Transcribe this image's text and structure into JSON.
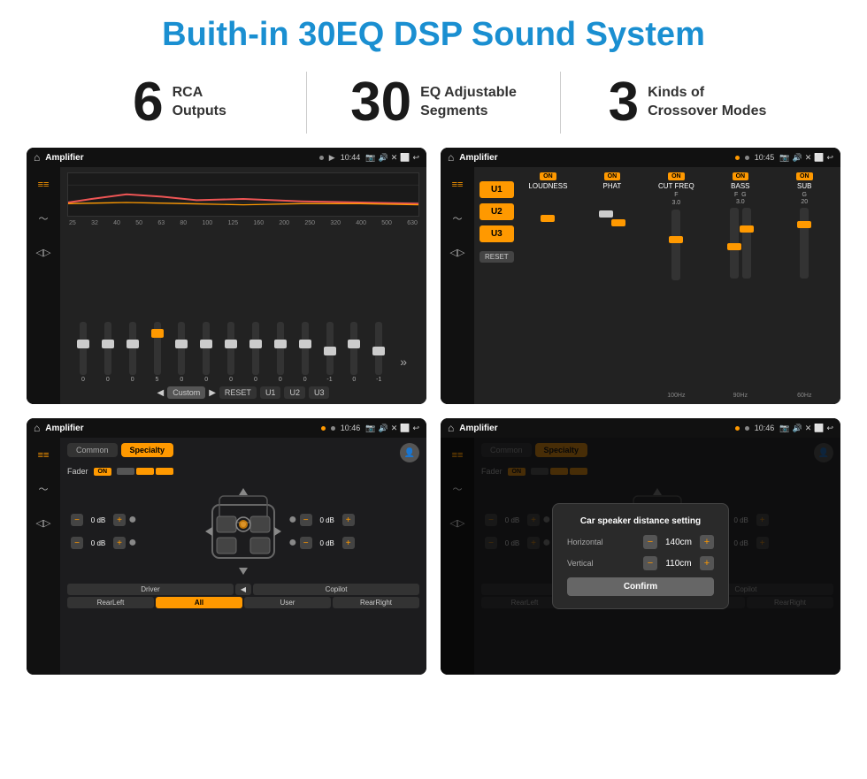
{
  "header": {
    "title": "Buith-in 30EQ DSP Sound System"
  },
  "stats": [
    {
      "number": "6",
      "label_line1": "RCA",
      "label_line2": "Outputs"
    },
    {
      "number": "30",
      "label_line1": "EQ Adjustable",
      "label_line2": "Segments"
    },
    {
      "number": "3",
      "label_line1": "Kinds of",
      "label_line2": "Crossover Modes"
    }
  ],
  "screens": [
    {
      "id": "eq-screen",
      "app_name": "Amplifier",
      "time": "10:44",
      "type": "eq",
      "freqs": [
        "25",
        "32",
        "40",
        "50",
        "63",
        "80",
        "100",
        "125",
        "160",
        "200",
        "250",
        "320",
        "400",
        "500",
        "630"
      ],
      "vals": [
        "0",
        "0",
        "0",
        "5",
        "0",
        "0",
        "0",
        "0",
        "0",
        "0",
        "-1",
        "0",
        "-1"
      ],
      "nav_items": [
        "Custom",
        "RESET",
        "U1",
        "U2",
        "U3"
      ]
    },
    {
      "id": "crossover-screen",
      "app_name": "Amplifier",
      "time": "10:45",
      "type": "crossover",
      "u_buttons": [
        "U1",
        "U2",
        "U3"
      ],
      "channels": [
        {
          "name": "LOUDNESS",
          "on": true,
          "val": ""
        },
        {
          "name": "PHAT",
          "on": true,
          "val": ""
        },
        {
          "name": "CUT FREQ",
          "on": true,
          "val": ""
        },
        {
          "name": "BASS",
          "on": true,
          "val": ""
        },
        {
          "name": "SUB",
          "on": true,
          "val": ""
        }
      ],
      "reset_label": "RESET"
    },
    {
      "id": "common-screen",
      "app_name": "Amplifier",
      "time": "10:46",
      "type": "common",
      "tabs": [
        "Common",
        "Specialty"
      ],
      "active_tab": "Specialty",
      "fader_label": "Fader",
      "fader_on": true,
      "spk_rows": [
        {
          "left_val": "0 dB",
          "right_val": "0 dB"
        },
        {
          "left_val": "0 dB",
          "right_val": "0 dB"
        }
      ],
      "bottom_nav": [
        "Driver",
        "",
        "",
        "",
        "Copilot",
        "RearLeft",
        "All",
        "",
        "User",
        "RearRight"
      ]
    },
    {
      "id": "dialog-screen",
      "app_name": "Amplifier",
      "time": "10:46",
      "type": "dialog",
      "dialog": {
        "title": "Car speaker distance setting",
        "horizontal_label": "Horizontal",
        "horizontal_val": "140cm",
        "vertical_label": "Vertical",
        "vertical_val": "110cm",
        "confirm_label": "Confirm"
      },
      "tabs": [
        "Common",
        "Specialty"
      ],
      "active_tab": "Common"
    }
  ]
}
